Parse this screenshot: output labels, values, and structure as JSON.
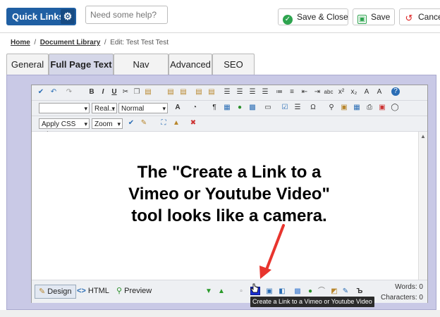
{
  "header": {
    "quick_links": "Quick Links",
    "help_placeholder": "Need some help?",
    "save_close": "Save & Close",
    "save": "Save",
    "cancel": "Cancel"
  },
  "breadcrumb": {
    "home": "Home",
    "library": "Document Library",
    "current": "Edit: Test Test Test",
    "sep": "/"
  },
  "tabs": [
    "General",
    "Full Page Text",
    "Nav Sections",
    "Advanced",
    "SEO"
  ],
  "toolbar": {
    "font_name": "Real...",
    "format": "Normal",
    "css_class": "Apply CSS Cl...",
    "zoom": "Zoom"
  },
  "editor": {
    "message_lines": [
      "The \"Create a Link to a",
      "Vimeo or Youtube Video\"",
      "tool looks like a camera."
    ]
  },
  "bottom": {
    "design": "Design",
    "html": "HTML",
    "preview": "Preview",
    "words": "Words: 0",
    "characters": "Characters: 0"
  },
  "tooltip": "Create a Link to a Vimeo or Youtube Video",
  "colors": {
    "accent": "#1f5fa3",
    "panel": "#c9c9e6",
    "arrow": "#e8352e"
  }
}
